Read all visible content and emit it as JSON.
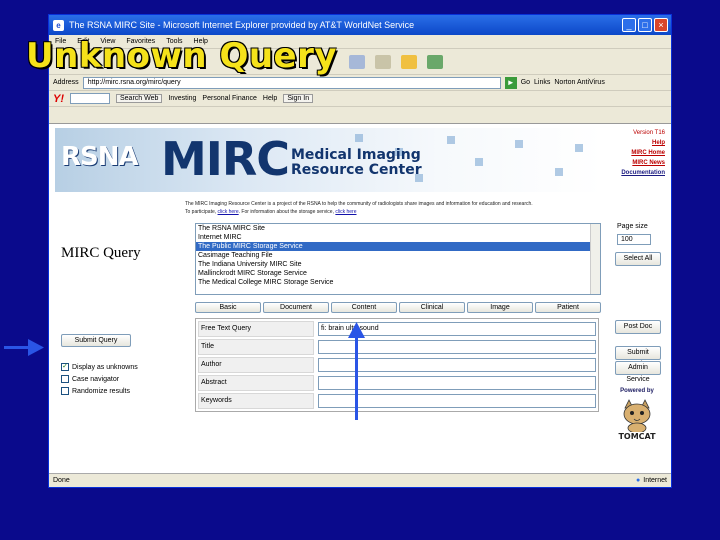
{
  "slide": {
    "title": "Unknown Query"
  },
  "window": {
    "title": "The RSNA MIRC Site - Microsoft Internet Explorer provided by AT&T WorldNet Service",
    "controls": [
      "_",
      "□",
      "×"
    ]
  },
  "menu": [
    "File",
    "Edit",
    "View",
    "Favorites",
    "Tools",
    "Help"
  ],
  "address": {
    "label": "Address",
    "url": "http://mirc.rsna.org/mirc/query",
    "go": "Go",
    "links": "Links",
    "norton": "Norton AntiVirus"
  },
  "yahoo": {
    "logo": "Y!",
    "search": "Search Web",
    "investing": "Investing",
    "finance": "Personal Finance",
    "help": "Help",
    "signin": "Sign In"
  },
  "banner": {
    "rsna": "RSNA",
    "mirc": "MIRC",
    "subtitle": "Medical Imaging Resource Center"
  },
  "side_links": {
    "version": "Version T16",
    "help": "Help",
    "home": "MIRC Home",
    "news": "MIRC News",
    "docs": "Documentation"
  },
  "intro": {
    "text": "The MIRC Imaging Resource Center is a project of the RSNA to help the community of radiologists share images and information for education and research. To participate, ",
    "link1": "click here",
    "text2": ". For information about the storage service, ",
    "link2": "click here"
  },
  "query": {
    "title": "MIRC Query",
    "servers": [
      "The RSNA MIRC Site",
      "Internet MIRC",
      "The Public MIRC Storage Service",
      "Casimage Teaching File",
      "The Indiana University MIRC Site",
      "Mallinckrodt MIRC Storage Service",
      "The Medical College MIRC Storage Service"
    ],
    "selected_server": 2,
    "page_size_label": "Page size",
    "page_size_value": "100",
    "select_all": "Select All",
    "tabs": [
      "Basic",
      "Document",
      "Content",
      "Clinical",
      "Image",
      "Patient"
    ],
    "submit_query": "Submit Query",
    "options": [
      {
        "label": "Display as unknowns",
        "checked": true
      },
      {
        "label": "Case navigator",
        "checked": false
      },
      {
        "label": "Randomize results",
        "checked": false
      }
    ],
    "fields": [
      {
        "label": "Free Text Query",
        "value": "fi: brain ultrasound"
      },
      {
        "label": "Title",
        "value": ""
      },
      {
        "label": "Author",
        "value": ""
      },
      {
        "label": "Abstract",
        "value": ""
      },
      {
        "label": "Keywords",
        "value": ""
      }
    ],
    "buttons": {
      "post_doc": "Post Doc",
      "submit_service": "Submit Service",
      "admin_service": "Admin Service"
    }
  },
  "tomcat": {
    "powered_by": "Powered by",
    "name": "TOMCAT"
  },
  "status": {
    "left": "Done",
    "right": "Internet"
  }
}
